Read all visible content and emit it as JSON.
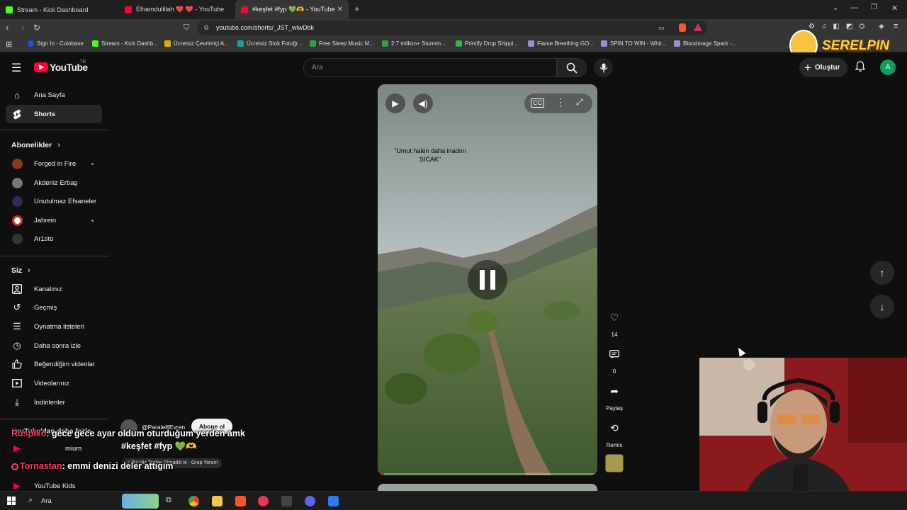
{
  "browser": {
    "tabs": [
      {
        "title": "Stream - Kick Dashboard",
        "color": "#53fc18"
      },
      {
        "title": "Elhamdulillah ❤️ ❤️ - YouTube",
        "color": "#ff0033"
      },
      {
        "title": "#keşfet #fyp 💚🫶 - YouTube",
        "color": "#ff0033"
      }
    ],
    "new_tab": "+",
    "url": "youtube.com/shorts/_JST_wlwDbk",
    "bookmarks": [
      {
        "label": "Sign In - Coinbase",
        "color": "#1652f0"
      },
      {
        "label": "Stream - Kick Dashb...",
        "color": "#53fc18"
      },
      {
        "label": "Ücretsiz Çevrimiçi A...",
        "color": "#e0b000"
      },
      {
        "label": "Ücretsiz Stok Fotoğr...",
        "color": "#1aa0a0"
      },
      {
        "label": "Free Sleep Music M...",
        "color": "#2fa043"
      },
      {
        "label": "2.7 million+ Stunnin...",
        "color": "#2fa043"
      },
      {
        "label": "Printify Drop Shippi...",
        "color": "#33b34c"
      },
      {
        "label": "Flame Breathing GO...",
        "color": "#9a8fd0"
      },
      {
        "label": "SPIN TO WIN - Whir...",
        "color": "#9a8fd0"
      },
      {
        "label": "Bloodmage Spark -...",
        "color": "#9a8fd0"
      }
    ]
  },
  "overlay_logo": "SERELPIN",
  "youtube": {
    "logo": "YouTube",
    "region": "TR",
    "search_placeholder": "Ara",
    "create_label": "Oluştur",
    "account_initial": "A"
  },
  "sidebar": {
    "main": [
      {
        "label": "Ana Sayfa",
        "icon": "home-icon"
      },
      {
        "label": "Shorts",
        "icon": "shorts-icon"
      }
    ],
    "subscriptions_title": "Abonelikler",
    "subscriptions": [
      {
        "label": "Forged in Fire",
        "color": "#8a3a1a",
        "new": true
      },
      {
        "label": "Akdeniz Erbaş",
        "color": "#777777",
        "new": false
      },
      {
        "label": "Unutulmaz Efsaneler",
        "color": "#2d2d55",
        "new": false
      },
      {
        "label": "Jahrein",
        "color": "#c0392b",
        "new": true
      },
      {
        "label": "Ar1sto",
        "color": "#333333",
        "new": false
      }
    ],
    "you_title": "Siz",
    "you": [
      {
        "label": "Kanalınız",
        "icon": "channel-icon"
      },
      {
        "label": "Geçmiş",
        "icon": "history-icon"
      },
      {
        "label": "Oynatma listeleri",
        "icon": "playlist-icon"
      },
      {
        "label": "Daha sonra izle",
        "icon": "watch-later-icon"
      },
      {
        "label": "Beğendiğim videolar",
        "icon": "like-icon"
      },
      {
        "label": "Videolarınız",
        "icon": "video-icon"
      },
      {
        "label": "İndirilenler",
        "icon": "download-icon"
      }
    ],
    "more_title": "YouTube'dan daha fazla",
    "more": [
      {
        "label": "mium"
      },
      {
        "label": "YouTube Kids"
      }
    ]
  },
  "short": {
    "caption": "\"Umut halen daha inadını\nSICAK\"",
    "channel": "@ParalelllEvren",
    "subscribe": "Abone ol",
    "title": "#keşfet #fyp 💚🫶",
    "song": "♫ Biz Hiç Teslim Olmadık ki · Grup Yorum",
    "actions": [
      {
        "name": "like",
        "label": "14"
      },
      {
        "name": "comments",
        "label": "0"
      },
      {
        "name": "share",
        "label": "Paylaş"
      },
      {
        "name": "remix",
        "label": "Remix"
      }
    ]
  },
  "chat": [
    {
      "user": "Ruspiko",
      "message": ": gece gece ayar oldum oturduğum yerden amk",
      "user_color": "#ff3b6b"
    },
    {
      "user": "Tornastan",
      "message": ": emmi denizi deler attığım",
      "user_color": "#ff3b6b"
    }
  ],
  "taskbar": {
    "search": "Ara"
  }
}
